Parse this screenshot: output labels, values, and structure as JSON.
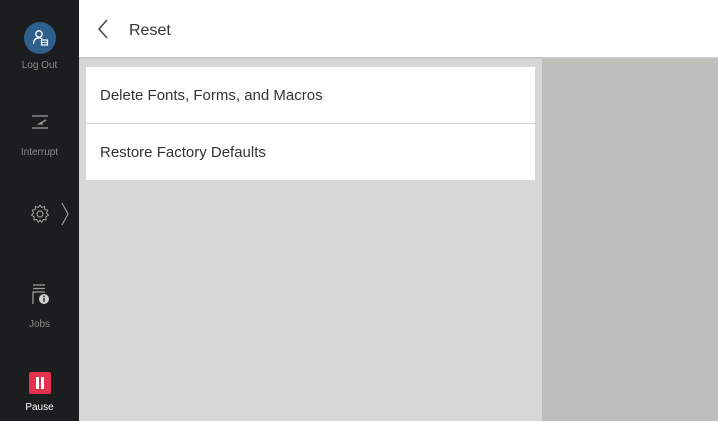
{
  "sidebar": {
    "logout_label": "Log Out",
    "interrupt_label": "Interrupt",
    "jobs_label": "Jobs",
    "pause_label": "Pause"
  },
  "header": {
    "title": "Reset"
  },
  "menu": {
    "items": [
      {
        "label": "Delete Fonts, Forms, and Macros"
      },
      {
        "label": "Restore Factory Defaults"
      }
    ]
  },
  "colors": {
    "sidebar_bg": "#1c1d1e",
    "logout_circle": "#2f5f8f",
    "pause_button": "#e4314d",
    "left_panel": "#d7d8d5",
    "right_panel": "#bebebb"
  },
  "icons": [
    "user-logout-icon",
    "interrupt-icon",
    "gear-icon",
    "chevron-right-icon",
    "jobs-icon",
    "pause-icon",
    "chevron-left-icon"
  ]
}
